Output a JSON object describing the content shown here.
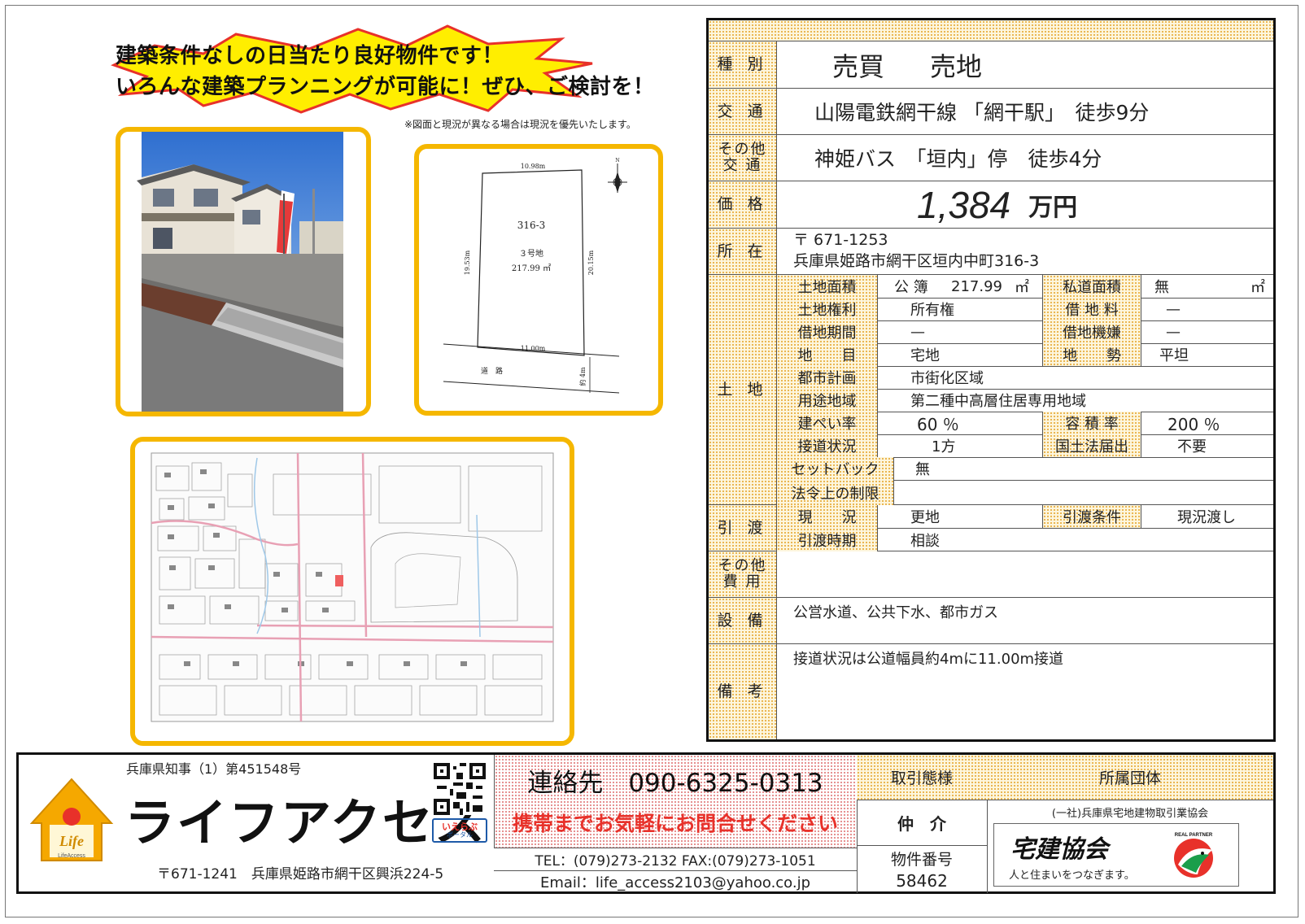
{
  "headline": {
    "line1": "建築条件なしの日当たり良好物件です！",
    "line2": "いろんな建築プランニングが可能に！ぜひ、ご検討を！"
  },
  "note": "※図面と現況が異なる場合は現況を優先いたします。",
  "lot_plan": {
    "top_width": "10.98m",
    "bottom_width": "11.00m",
    "left_depth": "19.53m",
    "right_depth": "20.15m",
    "lot_number": "316-3",
    "lot_name": "３号地",
    "area": "217.99 ㎡",
    "road_label": "道　路",
    "road_width": "約 4m",
    "north": "N"
  },
  "table": {
    "type_label": "種 別",
    "type_value1": "売買",
    "type_value2": "売地",
    "transport_label": "交 通",
    "transport_value": "山陽電鉄網干線 「網干駅」　徒歩9分",
    "other_transport_label1": "その他",
    "other_transport_label2": "交 通",
    "other_transport_value": "神姫バス　「垣内」停　徒歩4分",
    "price_label": "価 格",
    "price_number": "1,384",
    "price_unit": "万円",
    "address_label": "所 在",
    "postal": "〒 671-1253",
    "address": "兵庫県姫路市網干区垣内中町316-3",
    "land_label": "土 地",
    "land_area_label": "土地面積",
    "land_area_type": "公 簿",
    "land_area_value": "217.99",
    "land_area_unit": "㎡",
    "private_road_label": "私道面積",
    "private_road_value": "無",
    "private_road_unit": "㎡",
    "land_right_label": "土地権利",
    "land_right_value": "所有権",
    "lease_fee_label": "借 地 料",
    "lease_fee_value": "—",
    "lease_period_label": "借地期間",
    "lease_period_value": "—",
    "lease_agency_label": "借地機嫌",
    "lease_agency_value": "—",
    "category_label": "地　　目",
    "category_value": "宅地",
    "terrain_label": "地　　勢",
    "terrain_value": "平坦",
    "city_plan_label": "都市計画",
    "city_plan_value": "市街化区域",
    "zoning_label": "用途地域",
    "zoning_value": "第二種中高層住居専用地域",
    "coverage_label": "建ぺい率",
    "coverage_value": "60 ％",
    "far_label": "容 積 率",
    "far_value": "200 ％",
    "road_access_label": "接道状況",
    "road_access_value": "1方",
    "notify_label": "国土法届出",
    "notify_value": "不要",
    "setback_label": "セットバック",
    "setback_value": "無",
    "legal_label": "法令上の制限",
    "legal_value": "",
    "handover_label": "引 渡",
    "current_label": "現　　況",
    "current_value": "更地",
    "condition_label": "引渡条件",
    "condition_value": "現況渡し",
    "timing_label": "引渡時期",
    "timing_value": "相談",
    "other_cost_label1": "その他",
    "other_cost_label2": "費 用",
    "other_cost_value": "",
    "facility_label": "設 備",
    "facility_value": "公営水道、公共下水、都市ガス",
    "remarks_label": "備 考",
    "remarks_value": "接道状況は公道幅員約4mに11.00m接道"
  },
  "footer": {
    "license": "兵庫県知事（1）第451548号",
    "company": "ライフアクセス",
    "logo_text1": "Life",
    "logo_text2": "LifeAccess",
    "company_address": "〒671-1241　兵庫県姫路市網干区興浜224-5",
    "ieraboo": "いえらぶ",
    "ieraboo_sub": "ポータル",
    "contact_phone": "連絡先　090-6325-0313",
    "contact_note": "携帯までお気軽にお問合せください",
    "tel_fax": "TEL：(079)273-2132 FAX:(079)273-1051",
    "email": "Email：life_access2103@yahoo.co.jp",
    "transaction_label": "取引態様",
    "transaction_value": "仲　介",
    "property_no_label": "物件番号",
    "property_no_value": "58462",
    "association_label": "所属団体",
    "association_name": "(一社)兵庫県宅地建物取引業協会",
    "takken": "宅建協会",
    "takken_sub": "人と住まいをつなぎます。",
    "real_partner": "REAL PARTNER"
  },
  "colors": {
    "frame_yellow": "#f5b700",
    "burst_yellow": "#ffee00",
    "burst_red": "#e8312a",
    "logo_orange": "#f5a800",
    "takken_green": "#1b9e4b"
  }
}
